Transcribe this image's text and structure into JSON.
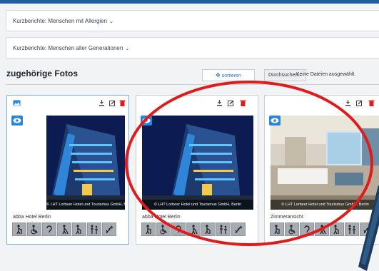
{
  "panels": {
    "allergies": "Kurzberichte: Menschen mit Allergien",
    "generations": "Kurzberichte: Menschen aller Generationen"
  },
  "photos_section": {
    "title": "zugehörige Fotos",
    "sort_label": "sortieren",
    "browse_label": "Durchsuchen...",
    "no_file_label": "Keine Dateien ausgewählt."
  },
  "cards": [
    {
      "caption": "© LHT Lorbeer Hotel und Tourismus GmbH, Berlin",
      "name": "abba Hotel Berlin",
      "photo": "hotel-exterior-night"
    },
    {
      "caption": "© LHT Lorbeer Hotel und Tourismus GmbH, Berlin",
      "name": "abba Hotel Berlin",
      "photo": "hotel-exterior-night"
    },
    {
      "caption": "© LHT Lorbeer Hotel und Tourismus GmbH, Berlin",
      "name": "Zimmeransicht",
      "photo": "hotel-room"
    }
  ],
  "accessibility_icons": [
    "walking-aid-icon",
    "wheelchair-icon",
    "hearing-icon",
    "blind-cane-icon",
    "elderly-icon",
    "family-icon",
    "allergy-icon"
  ],
  "colors": {
    "accent": "#2b86d8",
    "delete": "#e01b1b",
    "annotation": "#e01b1b"
  }
}
